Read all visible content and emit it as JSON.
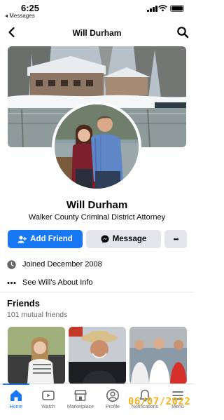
{
  "status_bar": {
    "time": "6:25",
    "back_app": "◂ Messages"
  },
  "header": {
    "title": "Will Durham"
  },
  "profile": {
    "name": "Will Durham",
    "subtitle": "Walker County Criminal District Attorney"
  },
  "actions": {
    "add_friend": "Add Friend",
    "message": "Message",
    "more": "•••"
  },
  "details": {
    "joined": "Joined December 2008",
    "about": "See Will's About Info"
  },
  "friends": {
    "title": "Friends",
    "count": "101 mutual friends"
  },
  "tabs": [
    {
      "label": "Home",
      "icon": "home-icon"
    },
    {
      "label": "Watch",
      "icon": "watch-icon"
    },
    {
      "label": "Marketplace",
      "icon": "marketplace-icon"
    },
    {
      "label": "Profile",
      "icon": "profile-icon"
    },
    {
      "label": "Notifications",
      "icon": "bell-icon"
    },
    {
      "label": "Menu",
      "icon": "menu-icon"
    }
  ],
  "watermark": "06/07/2022",
  "colors": {
    "accent": "#1877f2",
    "button_grey": "#e4e6eb",
    "secondary_text": "#65676b",
    "watermark": "#f3b11a"
  }
}
